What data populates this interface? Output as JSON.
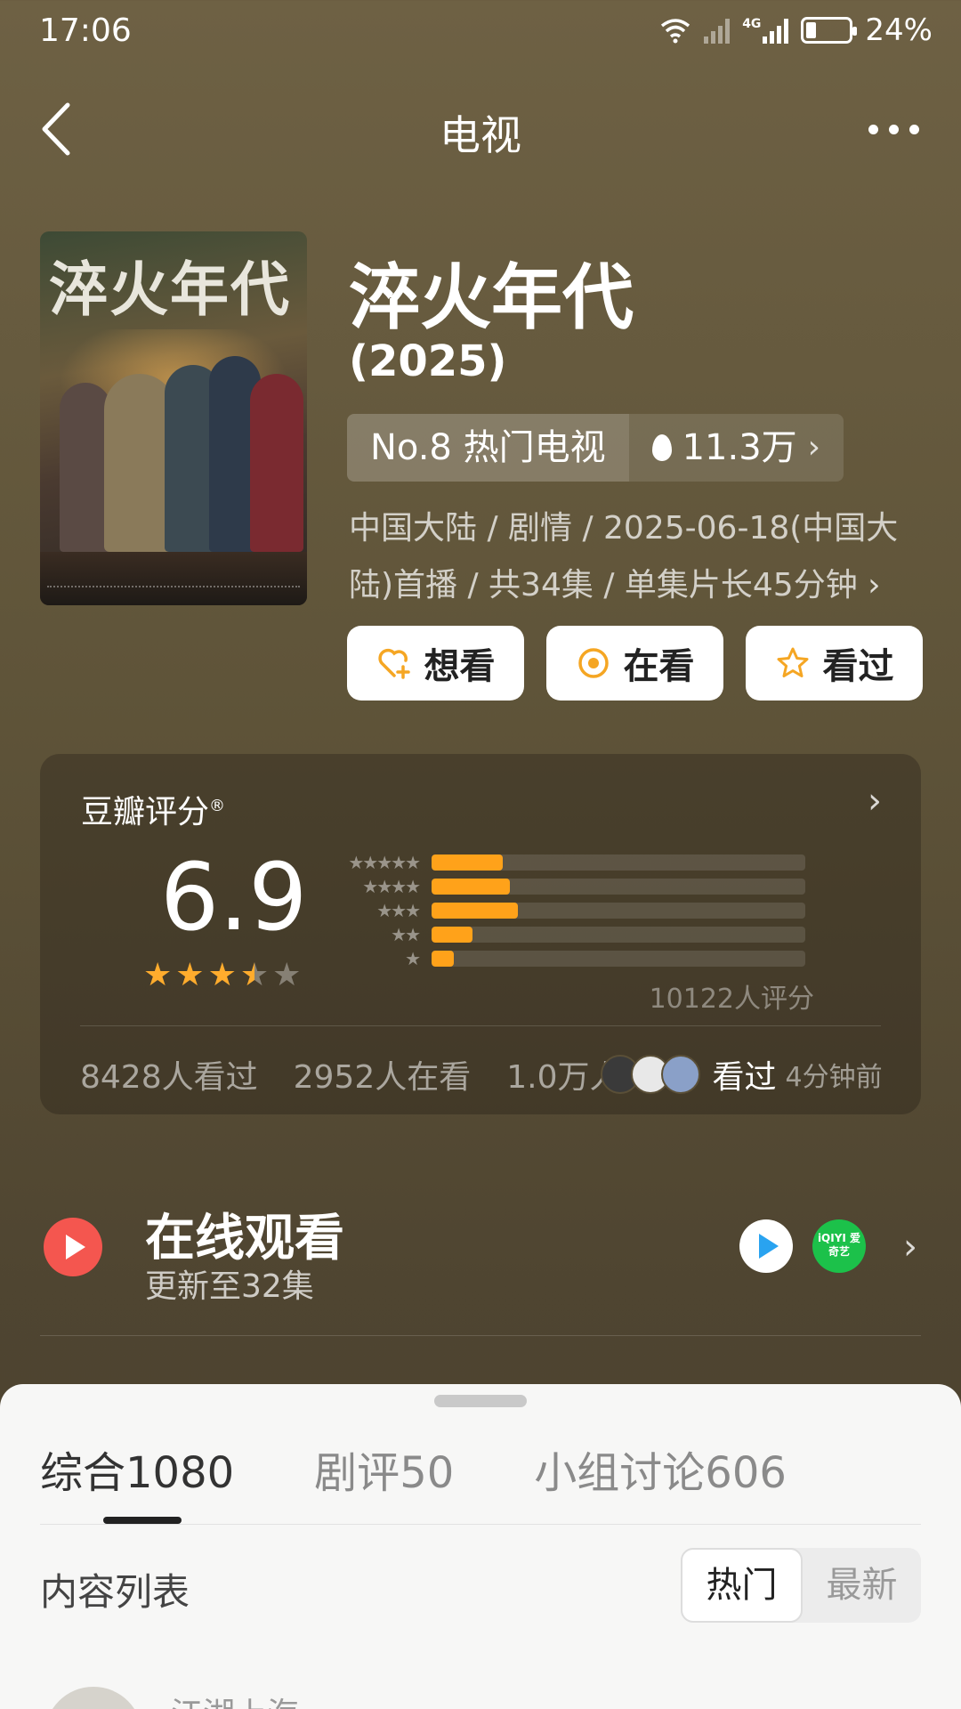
{
  "status_bar": {
    "time": "17:06",
    "network": "4G",
    "battery": "24%",
    "battery_level": 0.24
  },
  "nav": {
    "title": "电视"
  },
  "show": {
    "poster_title": "淬火年代",
    "title": "淬火年代",
    "year": "(2025)",
    "rank": "No.8 热门电视",
    "heat": "11.3万",
    "meta_line1": "中国大陆 / 剧情 / 2025-06-18(中国大",
    "meta_line2": "陆)首播 / 共34集 / 单集片长45分钟"
  },
  "actions": {
    "want": "想看",
    "watching": "在看",
    "watched": "看过"
  },
  "rating": {
    "label": "豆瓣评分",
    "score": "6.9",
    "stars": 3.5,
    "distribution": [
      {
        "stars": 5,
        "fraction": 0.19
      },
      {
        "stars": 4,
        "fraction": 0.21
      },
      {
        "stars": 3,
        "fraction": 0.23
      },
      {
        "stars": 2,
        "fraction": 0.11
      },
      {
        "stars": 1,
        "fraction": 0.06
      }
    ],
    "count": "10122人评分",
    "watched_count": "8428人看过",
    "watching_count": "2952人在看",
    "want_count": "1.0万人",
    "recent_label": "看过",
    "recent_time": "4分钟前"
  },
  "online": {
    "title": "在线观看",
    "subtitle": "更新至32集",
    "iqiyi_logo": "iQIYI 爱奇艺"
  },
  "sheet": {
    "tabs": [
      {
        "label": "综合",
        "count": "1080"
      },
      {
        "label": "剧评",
        "count": "50"
      },
      {
        "label": "小组讨论",
        "count": "606"
      }
    ],
    "list_header": "内容列表",
    "sort_hot": "热门",
    "sort_new": "最新",
    "peek_name": "江湖上海"
  },
  "colors": {
    "accent_orange": "#ffa21a",
    "play_red": "#f4564f",
    "iqiyi_green": "#1cc14a",
    "tencent_blue": "#29a3f0"
  }
}
